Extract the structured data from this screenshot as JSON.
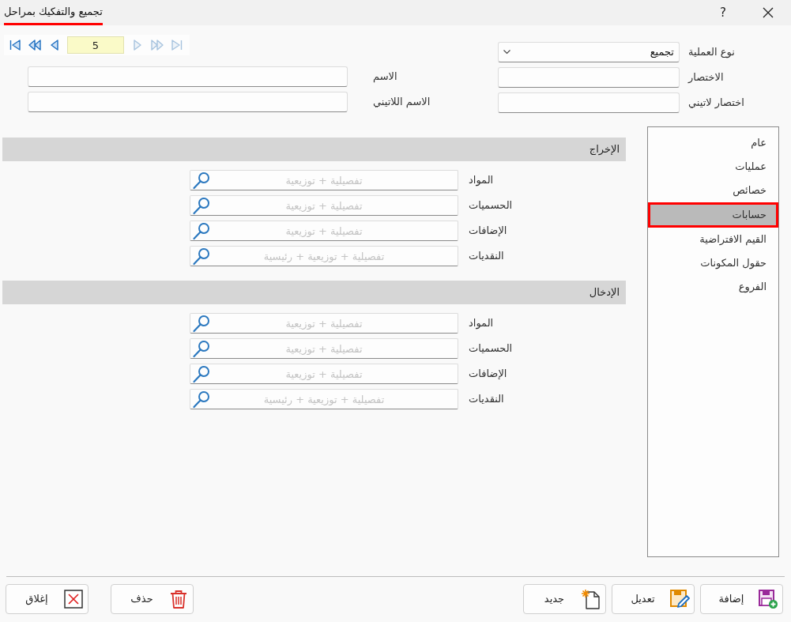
{
  "window": {
    "title": "تجميع والتفكيك بمراحل",
    "help": "?"
  },
  "navigator": {
    "value": "5",
    "back_buttons": [
      {
        "kind": "first",
        "disabled": false
      },
      {
        "kind": "rewind",
        "disabled": false
      },
      {
        "kind": "previous",
        "disabled": false
      }
    ],
    "forward_buttons": [
      {
        "kind": "next",
        "disabled": true
      },
      {
        "kind": "fast_forward",
        "disabled": true
      },
      {
        "kind": "last",
        "disabled": true
      }
    ]
  },
  "form": {
    "right_column": [
      {
        "kind": "dropdown",
        "label": "نوع العملية",
        "value": "تجميع"
      },
      {
        "kind": "text",
        "label": "الاختصار"
      },
      {
        "kind": "text",
        "label": "اختصار لاتيني"
      }
    ],
    "left_column": [
      {
        "kind": "text",
        "label": "الاسم"
      },
      {
        "kind": "text",
        "label": "الاسم اللاتيني"
      }
    ]
  },
  "sidebar": {
    "items": [
      {
        "label": "عام",
        "selected": false
      },
      {
        "label": "عمليات",
        "selected": false
      },
      {
        "label": "خصائص",
        "selected": false
      },
      {
        "label": "حسابات",
        "selected": true
      },
      {
        "label": "القيم الافتراضية",
        "selected": false
      },
      {
        "label": "حقول المكونات",
        "selected": false
      },
      {
        "label": "الفروع",
        "selected": false
      }
    ]
  },
  "sections": [
    {
      "title": "الإخراج",
      "rows": [
        {
          "label": "المواد",
          "placeholder": "تفصيلية + توزيعية"
        },
        {
          "label": "الحسميات",
          "placeholder": "تفصيلية + توزيعية"
        },
        {
          "label": "الإضافات",
          "placeholder": "تفصيلية + توزيعية"
        },
        {
          "label": "النقديات",
          "placeholder": "تفصيلية + توزيعية + رئيسية"
        }
      ]
    },
    {
      "title": "الإدخال",
      "rows": [
        {
          "label": "المواد",
          "placeholder": "تفصيلية + توزيعية"
        },
        {
          "label": "الحسميات",
          "placeholder": "تفصيلية + توزيعية"
        },
        {
          "label": "الإضافات",
          "placeholder": "تفصيلية + توزيعية"
        },
        {
          "label": "النقديات",
          "placeholder": "تفصيلية + توزيعية + رئيسية"
        }
      ]
    }
  ],
  "footer": {
    "right_buttons": [
      {
        "kind": "add",
        "label": "إضافة"
      },
      {
        "kind": "edit",
        "label": "تعديل"
      },
      {
        "kind": "new",
        "label": "جديد"
      }
    ],
    "left_buttons": [
      {
        "kind": "delete",
        "label": "حذف"
      },
      {
        "kind": "close",
        "label": "إغلاق"
      }
    ]
  }
}
